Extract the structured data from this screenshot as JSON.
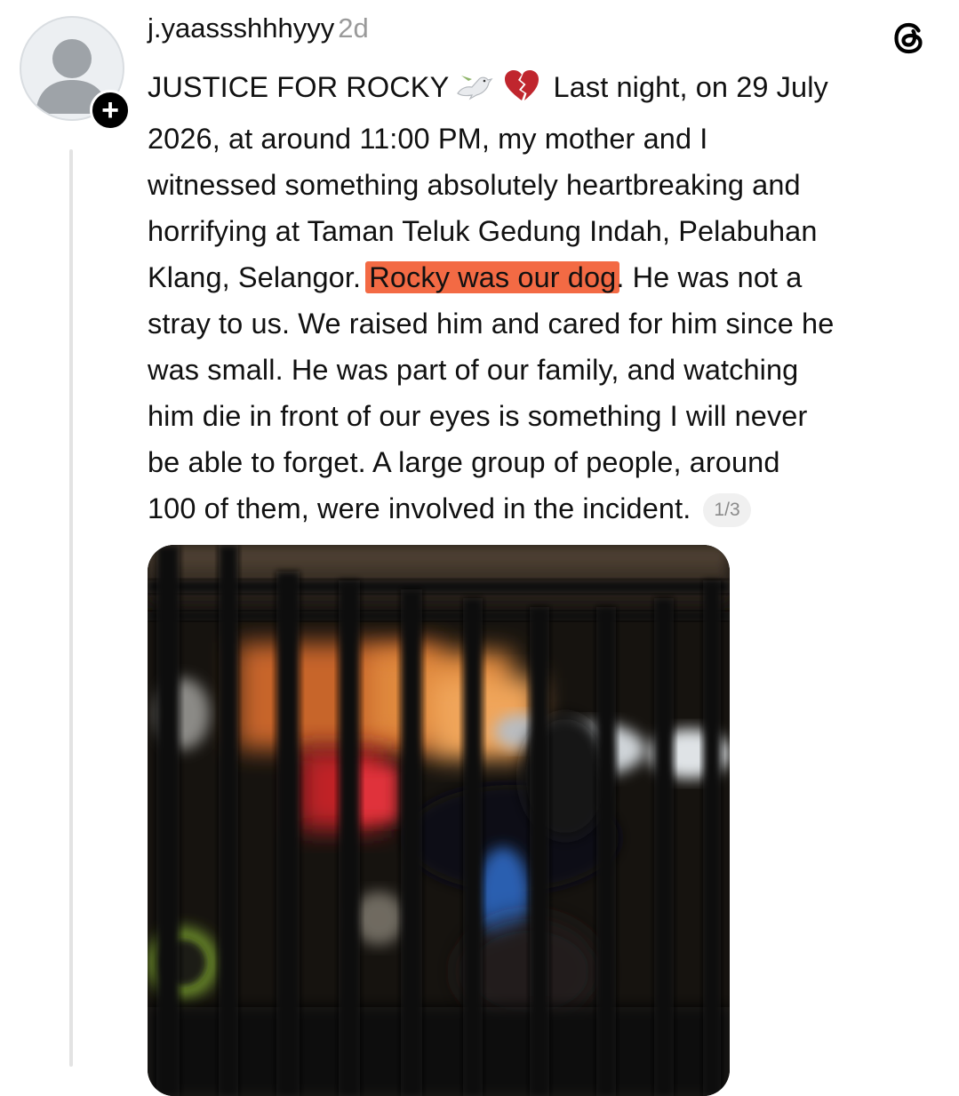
{
  "post": {
    "username": "j.yaassshhhyyy",
    "time": "2d",
    "text_lines": {
      "l1_a": "JUSTICE FOR ROCKY",
      "l1_b": "Last night, on 29 July",
      "l2": "2026, at around 11:00 PM, my mother and I",
      "l3": "witnessed something absolutely heartbreaking and",
      "l4": "horrifying at Taman Teluk Gedung Indah, Pelabuhan",
      "l5_a": "Klang, Selangor. ",
      "l5_highlight": "Rocky was our dog",
      "l5_b": ". He was not a",
      "l6": "stray to us. We raised him and cared for him since he",
      "l7": "was small. He was part of our family, and watching",
      "l8": "him die in front of our eyes is something I will never",
      "l9": "be able to forget. A large group of people, around",
      "l10": "100 of them, were involved in the incident."
    },
    "page_indicator": "1/3",
    "highlight_color": "#f36a44"
  },
  "icons": {
    "avatar": "default-avatar-icon",
    "follow": "plus-icon",
    "logo": "threads-logo-icon",
    "emoji_1": "dove-emoji",
    "emoji_2": "broken-heart-emoji"
  }
}
